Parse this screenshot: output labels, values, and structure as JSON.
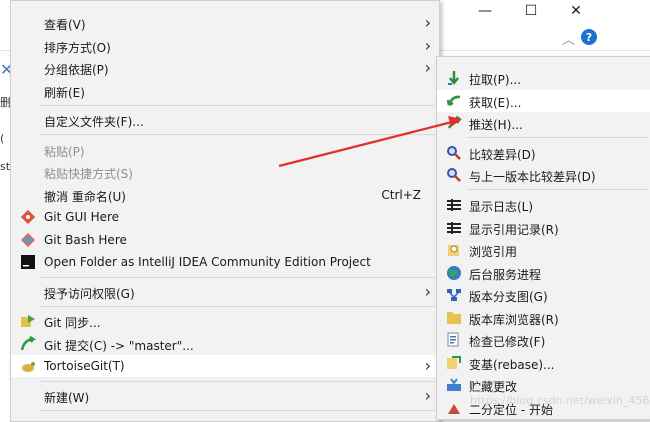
{
  "window": {
    "minimize_glyph": "—",
    "maximize_glyph": "☐",
    "close_glyph": "✕"
  },
  "background": {
    "fragments": [
      "删",
      "(",
      "st"
    ]
  },
  "main_menu": {
    "items": [
      {
        "label": "查看(V)",
        "submenu": true
      },
      {
        "label": "排序方式(O)",
        "submenu": true
      },
      {
        "label": "分组依据(P)",
        "submenu": true
      },
      {
        "label": "刷新(E)"
      },
      {
        "label": "自定义文件夹(F)..."
      },
      {
        "label": "粘贴(P)",
        "disabled": true
      },
      {
        "label": "粘贴快捷方式(S)",
        "disabled": true
      },
      {
        "label": "撤消 重命名(U)",
        "shortcut": "Ctrl+Z"
      },
      {
        "label": "Git GUI Here",
        "icon": "git-gui-icon"
      },
      {
        "label": "Git Bash Here",
        "icon": "git-bash-icon"
      },
      {
        "label": "Open Folder as IntelliJ IDEA Community Edition Project",
        "icon": "intellij-icon"
      },
      {
        "label": "授予访问权限(G)",
        "submenu": true
      },
      {
        "label": "Git 同步...",
        "icon": "git-sync-icon"
      },
      {
        "label": "Git 提交(C) -> \"master\"...",
        "icon": "git-commit-icon"
      },
      {
        "label": "TortoiseGit(T)",
        "icon": "tortoisegit-icon",
        "submenu": true,
        "highlight": true
      },
      {
        "label": "新建(W)",
        "submenu": true
      }
    ]
  },
  "sub_menu": {
    "items": [
      {
        "label": "拉取(P)...",
        "icon": "pull-icon"
      },
      {
        "label": "获取(E)...",
        "icon": "fetch-icon",
        "highlight": true
      },
      {
        "label": "推送(H)...",
        "icon": "push-icon"
      },
      {
        "label": "比较差异(D)",
        "icon": "diff-icon"
      },
      {
        "label": "与上一版本比较差异(D)",
        "icon": "diff-previous-icon"
      },
      {
        "label": "显示日志(L)",
        "icon": "show-log-icon"
      },
      {
        "label": "显示引用记录(R)",
        "icon": "reflog-icon"
      },
      {
        "label": "浏览引用",
        "icon": "browse-refs-icon"
      },
      {
        "label": "后台服务进程",
        "icon": "daemon-icon"
      },
      {
        "label": "版本分支图(G)",
        "icon": "revision-graph-icon"
      },
      {
        "label": "版本库浏览器(R)",
        "icon": "repo-browser-icon"
      },
      {
        "label": "检查已修改(F)",
        "icon": "check-modifications-icon"
      },
      {
        "label": "变基(rebase)...",
        "icon": "rebase-icon"
      },
      {
        "label": "贮藏更改",
        "icon": "stash-icon"
      },
      {
        "label": "二分定位 - 开始",
        "icon": "bisect-icon"
      }
    ]
  },
  "watermark": "https://blog.csdn.net/weixin_45650626",
  "colors": {
    "menu_bg": "#f2f2f2",
    "highlight_bg": "#ffffff",
    "arrow": "#e03030",
    "help_icon": "#1874d0"
  }
}
